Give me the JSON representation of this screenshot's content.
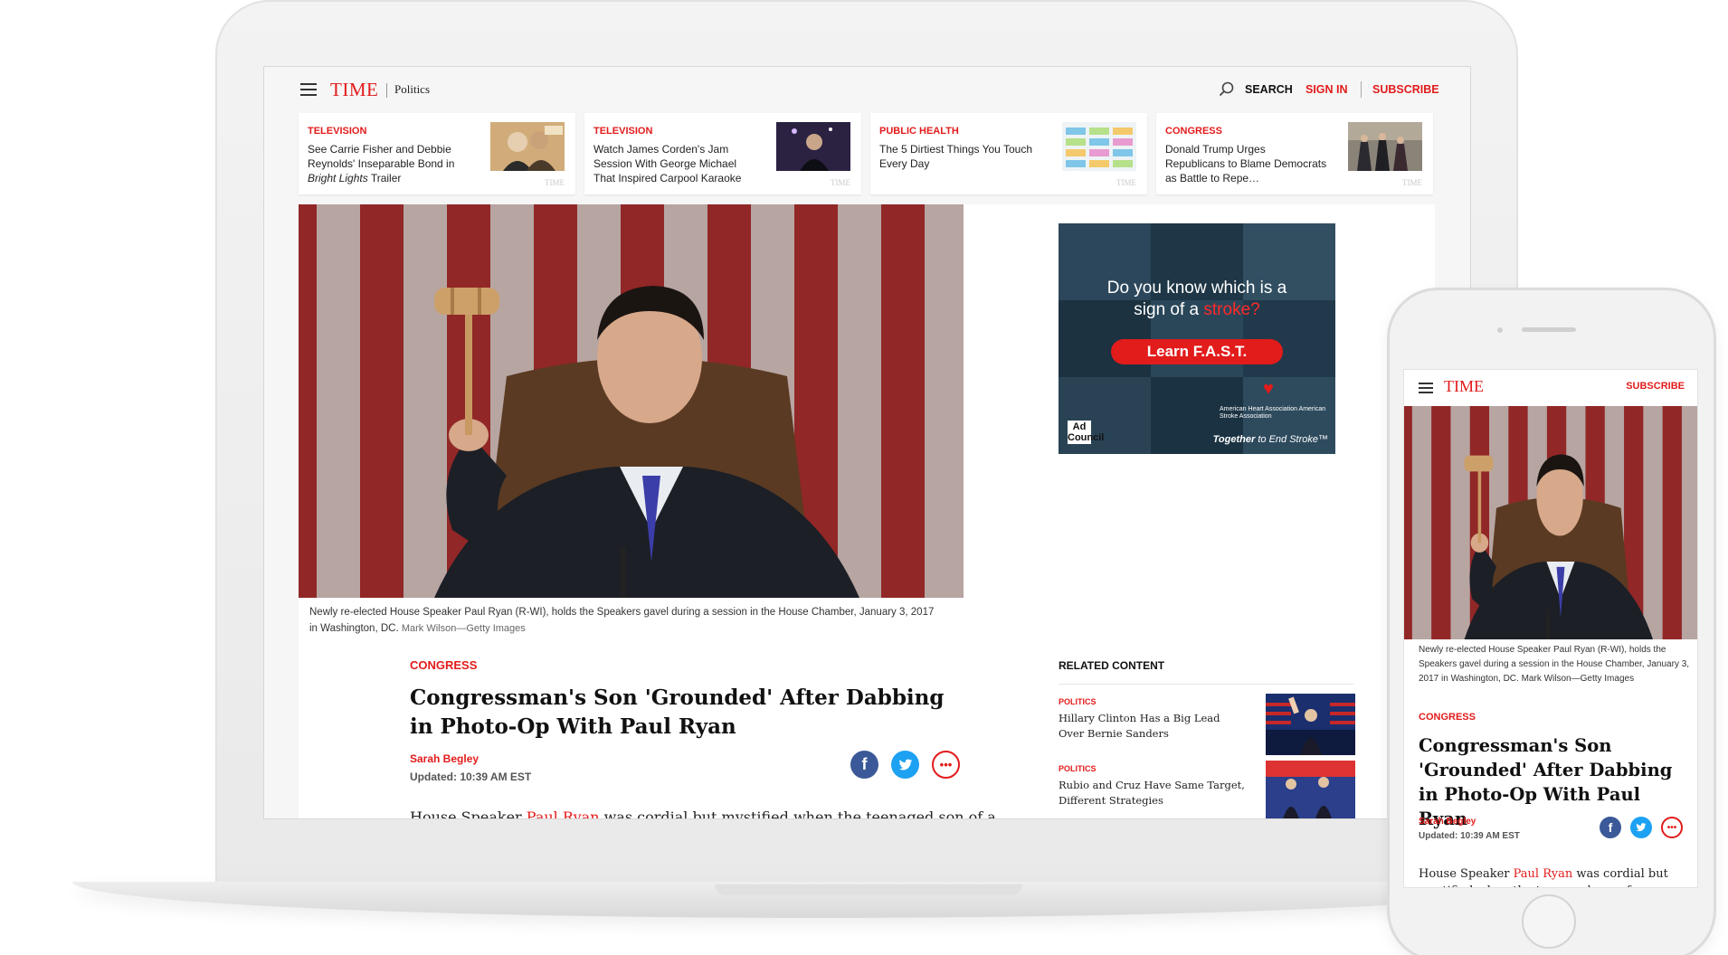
{
  "nav": {
    "logo": "TIME",
    "section": "Politics",
    "search_label": "SEARCH",
    "signin_label": "SIGN IN",
    "subscribe_label": "SUBSCRIBE"
  },
  "promos": [
    {
      "kicker": "TELEVISION",
      "title_html_parts": [
        "See Carrie Fisher and Debbie Reynolds' Inseparable Bond in ",
        "Bright Lights",
        " Trailer"
      ],
      "watermark": "TIME"
    },
    {
      "kicker": "TELEVISION",
      "title": "Watch James Corden's Jam Session With George Michael That Inspired Carpool Karaoke",
      "watermark": "TIME"
    },
    {
      "kicker": "PUBLIC HEALTH",
      "title": "The 5 Dirtiest Things You Touch Every Day",
      "watermark": "TIME"
    },
    {
      "kicker": "CONGRESS",
      "title": "Donald Trump Urges Republicans to Blame Democrats as Battle to Repe…",
      "watermark": "TIME"
    }
  ],
  "article": {
    "caption": "Newly re-elected House Speaker Paul Ryan (R-WI), holds the Speakers gavel during a session in the House Chamber, January 3, 2017 in Washington, DC.",
    "credit": "Mark Wilson—Getty Images",
    "kicker": "CONGRESS",
    "headline": "Congressman's Son 'Grounded' After Dabbing in Photo-Op With Paul Ryan",
    "author": "Sarah Begley",
    "updated": "Updated: 10:39 AM EST",
    "body_lead": "House Speaker ",
    "body_link": "Paul Ryan",
    "body_rest": " was cordial but mystified when the teenaged son of a"
  },
  "ad": {
    "question_line1": "Do you know which is a",
    "question_line2_pre": "sign of a ",
    "question_line2_red": "stroke?",
    "button": "Learn F.A.S.T.",
    "adcouncil": "Ad Council",
    "aha": "American Heart Association   American Stroke Association",
    "tagline_pre": "Together",
    "tagline_rest": " to End Stroke™"
  },
  "related": {
    "heading": "RELATED CONTENT",
    "items": [
      {
        "kicker": "POLITICS",
        "title": "Hillary Clinton Has a Big Lead Over Bernie Sanders"
      },
      {
        "kicker": "POLITICS",
        "title": "Rubio and Cruz Have Same Target, Different Strategies"
      }
    ]
  },
  "mobile": {
    "logo": "TIME",
    "subscribe": "SUBSCRIBE",
    "caption": "Newly re-elected House Speaker Paul Ryan (R-WI), holds the Speakers gavel during a session in the House Chamber, January 3, 2017 in Washington, DC.",
    "credit": "Mark Wilson—Getty Images",
    "kicker": "CONGRESS",
    "headline": "Congressman's Son 'Grounded' After Dabbing in Photo-Op With Paul Ryan",
    "author": "Sarah Begley",
    "updated": "Updated: 10:39 AM EST",
    "body_lead": "House Speaker ",
    "body_link": "Paul Ryan",
    "body_rest": " was cordial but mystified when the teenaged son of a new"
  },
  "colors": {
    "accent": "#e21b1b",
    "facebook": "#3b5998",
    "twitter": "#1da1f2"
  },
  "icons": [
    "hamburger-icon",
    "search-icon",
    "facebook-icon",
    "twitter-icon",
    "more-icon"
  ]
}
